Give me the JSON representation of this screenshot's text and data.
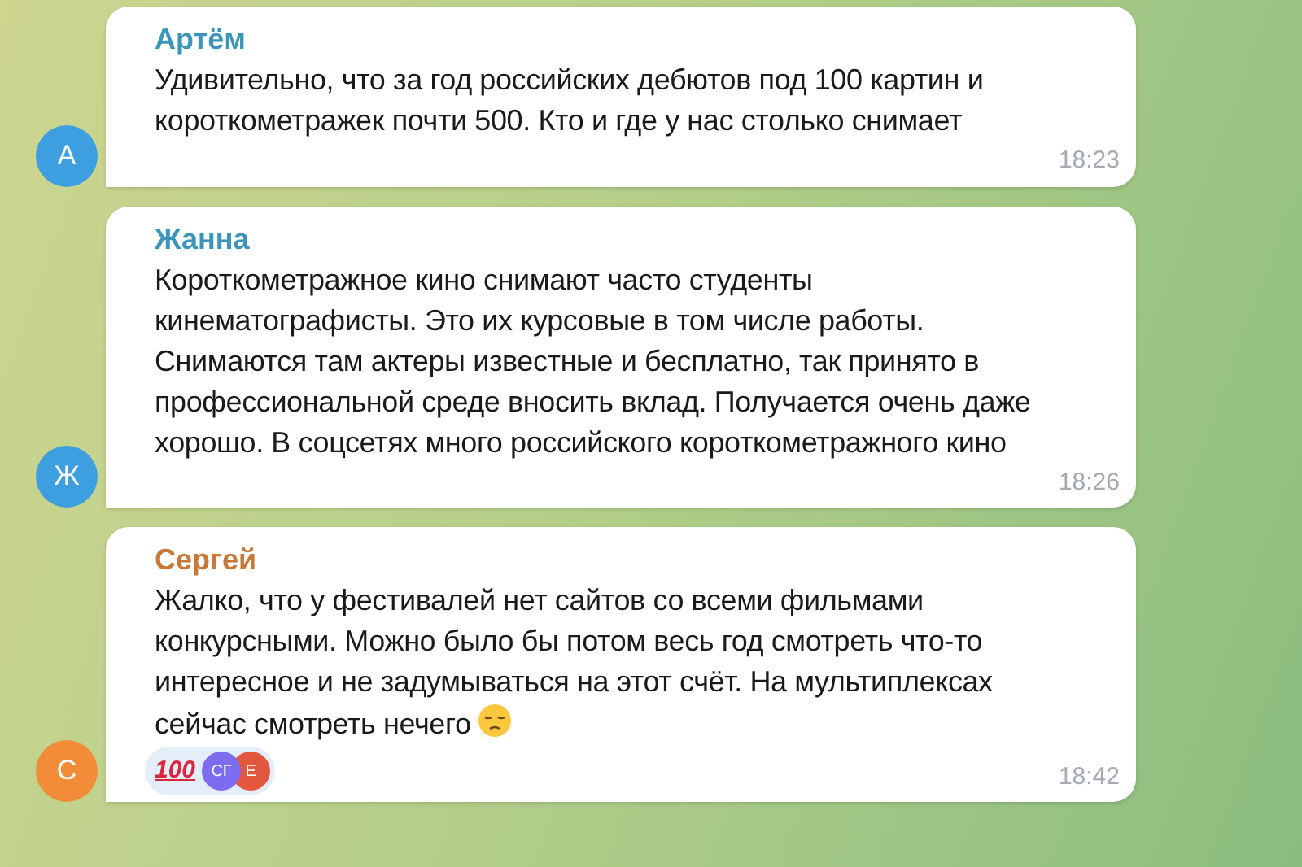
{
  "messages": [
    {
      "author": {
        "name": "Артём",
        "color": "#3a95b8"
      },
      "avatar": {
        "initials": "А",
        "color": "#3d9ee0"
      },
      "lines": [
        "Удивительно, что за год российских дебютов под 100 картин и",
        "короткометражек почти 500. Кто и где у нас столько снимает"
      ],
      "time": "18:23"
    },
    {
      "author": {
        "name": "Жанна",
        "color": "#3a95b8"
      },
      "avatar": {
        "initials": "Ж",
        "color": "#3d9ee0"
      },
      "lines": [
        "Короткометражное кино снимают часто студенты",
        "кинематографисты. Это их курсовые в том числе работы.",
        "Снимаются там актеры известные и бесплатно, так принято в",
        "профессиональной среде вносить вклад. Получается очень даже",
        "хорошо. В соцсетях много российского короткометражного кино"
      ],
      "time": "18:26"
    },
    {
      "author": {
        "name": "Сергей",
        "color": "#c8793a"
      },
      "avatar": {
        "initials": "С",
        "color": "#f28c38"
      },
      "lines": [
        "Жалко, что у фестивалей нет сайтов со всеми фильмами",
        "конкурсными. Можно было бы потом весь год смотреть что-то",
        "интересное и не задумываться на этот счёт. На мультиплексах",
        "сейчас смотреть нечего"
      ],
      "emoji_end": true,
      "reaction": {
        "label": "100",
        "users": [
          {
            "initials": "СГ",
            "color": "#7d6cf0"
          },
          {
            "initials": "Е",
            "color": "#e4573f"
          }
        ]
      },
      "time": "18:42"
    }
  ]
}
